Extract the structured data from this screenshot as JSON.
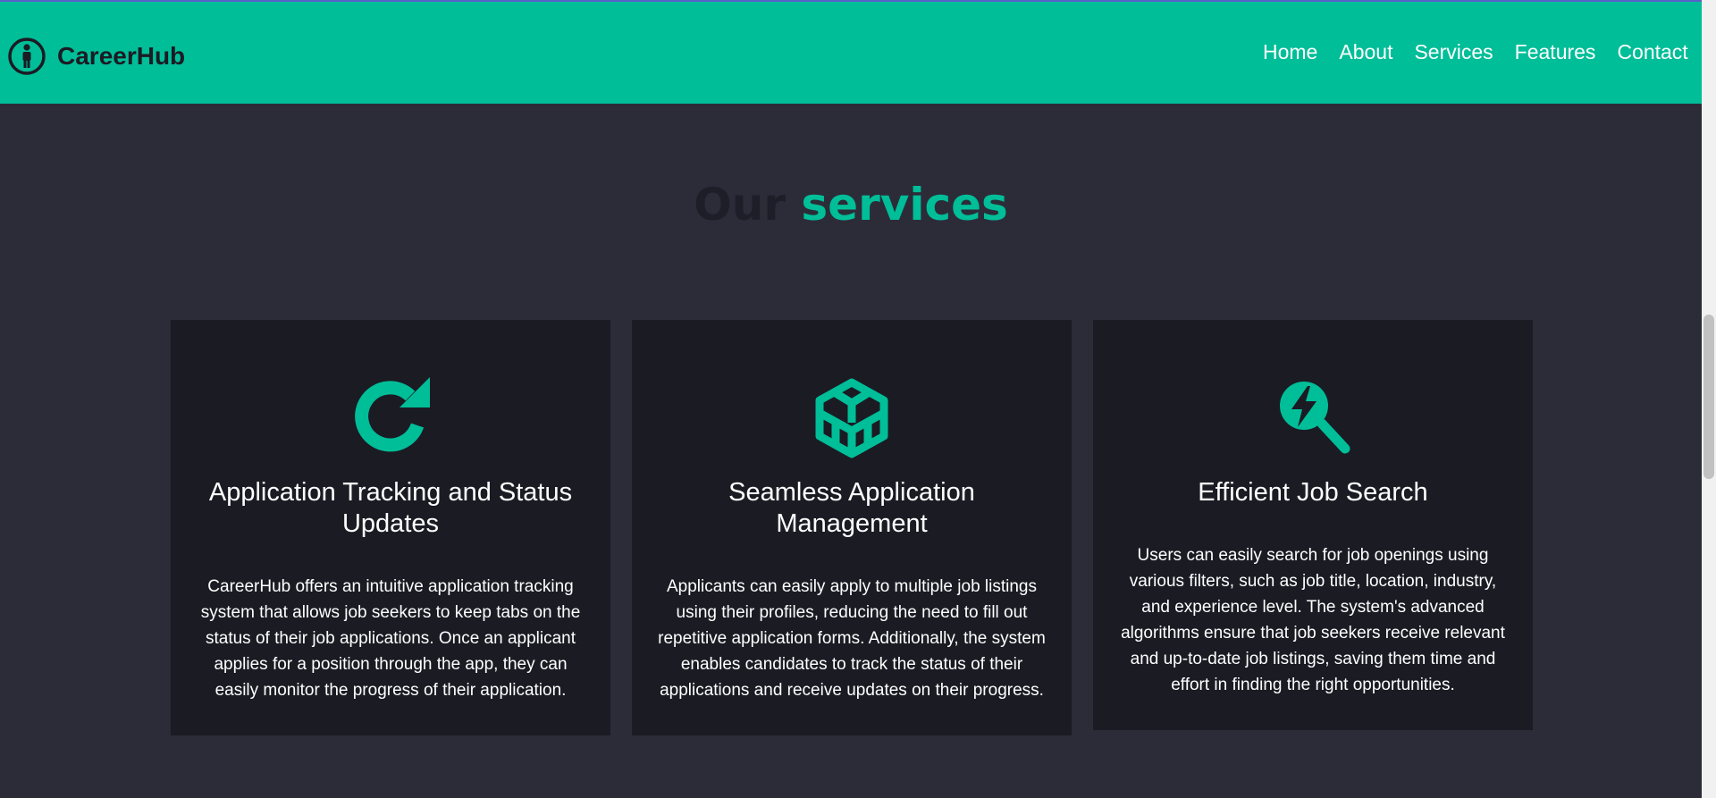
{
  "brand": {
    "name": "CareerHub",
    "icon": "person-in-circle-icon"
  },
  "nav": {
    "items": [
      {
        "label": "Home"
      },
      {
        "label": "About"
      },
      {
        "label": "Services"
      },
      {
        "label": "Features"
      },
      {
        "label": "Contact"
      }
    ]
  },
  "section": {
    "title_part1": "Our",
    "title_part2": "services"
  },
  "cards": [
    {
      "icon": "refresh-icon",
      "title": "Application Tracking and Status Updates",
      "text": "CareerHub offers an intuitive application tracking system that allows job seekers to keep tabs on the status of their job applications. Once an applicant applies for a position through the app, they can easily monitor the progress of their application."
    },
    {
      "icon": "cube-icon",
      "title": "Seamless Application Management",
      "text": "Applicants can easily apply to multiple job listings using their profiles, reducing the need to fill out repetitive application forms. Additionally, the system enables candidates to track the status of their applications and receive updates on their progress."
    },
    {
      "icon": "search-bolt-icon",
      "title": "Efficient Job Search",
      "text": "Users can easily search for job openings using various filters, such as job title, location, industry, and experience level. The system's advanced algorithms ensure that job seekers receive relevant and up-to-date job listings, saving them time and effort in finding the right opportunities."
    }
  ],
  "colors": {
    "accent": "#00be98",
    "background": "#2c2c38",
    "card": "#1b1b24"
  }
}
